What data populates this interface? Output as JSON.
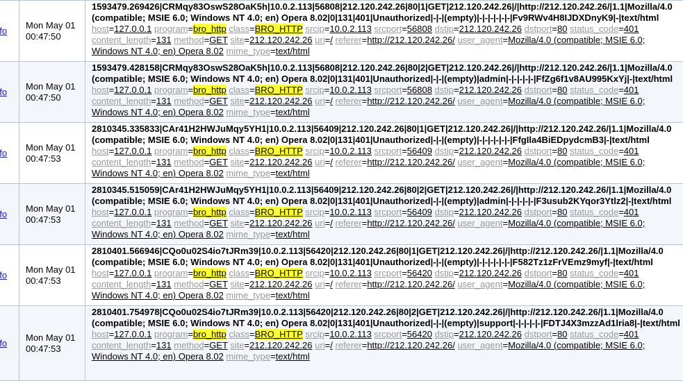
{
  "colors": {
    "highlight": "#ffff33",
    "key_text": "#999999",
    "row_alt_bg": "#f3f6fa",
    "border": "#b8c3d0",
    "link": "#1a1aa6"
  },
  "info_label": "nfo",
  "rows": [
    {
      "date": "Mon May 01",
      "time": "00:47:50",
      "raw": "1593479.269426|CRMqy83OswS28OaK5h|10.0.2.113|56808|212.120.242.26|80|1|GET|212.120.242.26|/|http://212.120.242.26/|1.1|Mozilla/4.0 (compatible; MSIE 6.0; Windows NT 4.0; en) Opera 8.02|0|131|401|Unauthorized|-|-|(empty)|-|-|-|-|-|-|Fv9RWv4H8IJDXDnyK9|-|text/html",
      "host": "127.0.0.1",
      "program": "bro_http",
      "class": "BRO_HTTP",
      "srcip": "10.0.2.113",
      "srcport": "56808",
      "dstip": "212.120.242.26",
      "dstport": "80",
      "status_code": "401",
      "content_length": "131",
      "method": "GET",
      "site": "212.120.242.26",
      "uri": "/",
      "referer": "http://212.120.242.26/",
      "user_agent": "Mozilla/4.0 (compatible; MSIE 6.0; Windows NT 4.0; en) Opera 8.02",
      "mime_type": "text/html"
    },
    {
      "date": "Mon May 01",
      "time": "00:47:50",
      "raw": "1593479.428158|CRMqy83OswS28OaK5h|10.0.2.113|56808|212.120.242.26|80|2|GET|212.120.242.26|/|http://212.120.242.26/|1.1|Mozilla/4.0 (compatible; MSIE 6.0; Windows NT 4.0; en) Opera 8.02|0|131|401|Unauthorized|-|-|(empty)|admin|-|-|-|-|-|FfZg6f1v8AU995KxYj|-|text/html",
      "host": "127.0.0.1",
      "program": "bro_http",
      "class": "BRO_HTTP",
      "srcip": "10.0.2.113",
      "srcport": "56808",
      "dstip": "212.120.242.26",
      "dstport": "80",
      "status_code": "401",
      "content_length": "131",
      "method": "GET",
      "site": "212.120.242.26",
      "uri": "/",
      "referer": "http://212.120.242.26/",
      "user_agent": "Mozilla/4.0 (compatible; MSIE 6.0; Windows NT 4.0; en) Opera 8.02",
      "mime_type": "text/html"
    },
    {
      "date": "Mon May 01",
      "time": "00:47:53",
      "raw": "2810345.335833|CAr41H2HWJuMqy5YH1|10.0.2.113|56409|212.120.242.26|80|1|GET|212.120.242.26|/|http://212.120.242.26/|1.1|Mozilla/4.0 (compatible; MSIE 6.0; Windows NT 4.0; en) Opera 8.02|0|131|401|Unauthorized|-|-|(empty)|-|-|-|-|-|-|FfgIla4BiEDpydcmB3|-|text/html",
      "host": "127.0.0.1",
      "program": "bro_http",
      "class": "BRO_HTTP",
      "srcip": "10.0.2.113",
      "srcport": "56409",
      "dstip": "212.120.242.26",
      "dstport": "80",
      "status_code": "401",
      "content_length": "131",
      "method": "GET",
      "site": "212.120.242.26",
      "uri": "/",
      "referer": "http://212.120.242.26/",
      "user_agent": "Mozilla/4.0 (compatible; MSIE 6.0; Windows NT 4.0; en) Opera 8.02",
      "mime_type": "text/html"
    },
    {
      "date": "Mon May 01",
      "time": "00:47:53",
      "raw": "2810345.515059|CAr41H2HWJuMqy5YH1|10.0.2.113|56409|212.120.242.26|80|2|GET|212.120.242.26|/|http://212.120.242.26/|1.1|Mozilla/4.0 (compatible; MSIE 6.0; Windows NT 4.0; en) Opera 8.02|0|131|401|Unauthorized|-|-|(empty)|admin|-|-|-|-|-|F3usub2KYqor3Ytlz2|-|text/html",
      "host": "127.0.0.1",
      "program": "bro_http",
      "class": "BRO_HTTP",
      "srcip": "10.0.2.113",
      "srcport": "56409",
      "dstip": "212.120.242.26",
      "dstport": "80",
      "status_code": "401",
      "content_length": "131",
      "method": "GET",
      "site": "212.120.242.26",
      "uri": "/",
      "referer": "http://212.120.242.26/",
      "user_agent": "Mozilla/4.0 (compatible; MSIE 6.0; Windows NT 4.0; en) Opera 8.02",
      "mime_type": "text/html"
    },
    {
      "date": "Mon May 01",
      "time": "00:47:53",
      "raw": "2810401.566946|CQo0u02S4io7tJRm39|10.0.2.113|56420|212.120.242.26|80|1|GET|212.120.242.26|/|http://212.120.242.26/|1.1|Mozilla/4.0 (compatible; MSIE 6.0; Windows NT 4.0; en) Opera 8.02|0|131|401|Unauthorized|-|-|(empty)|-|-|-|-|-|-|F582Tz1zFrVEmz9myf|-|text/html",
      "host": "127.0.0.1",
      "program": "bro_http",
      "class": "BRO_HTTP",
      "srcip": "10.0.2.113",
      "srcport": "56420",
      "dstip": "212.120.242.26",
      "dstport": "80",
      "status_code": "401",
      "content_length": "131",
      "method": "GET",
      "site": "212.120.242.26",
      "uri": "/",
      "referer": "http://212.120.242.26/",
      "user_agent": "Mozilla/4.0 (compatible; MSIE 6.0; Windows NT 4.0; en) Opera 8.02",
      "mime_type": "text/html"
    },
    {
      "date": "Mon May 01",
      "time": "00:47:53",
      "raw": "2810401.754978|CQo0u02S4io7tJRm39|10.0.2.113|56420|212.120.242.26|80|2|GET|212.120.242.26|/|http://212.120.242.26/|1.1|Mozilla/4.0 (compatible; MSIE 6.0; Windows NT 4.0; en) Opera 8.02|0|131|401|Unauthorized|-|-|(empty)|support|-|-|-|-|-|FDTJ4X3mzzAd1lria8|-|text/html",
      "host": "127.0.0.1",
      "program": "bro_http",
      "class": "BRO_HTTP",
      "srcip": "10.0.2.113",
      "srcport": "56420",
      "dstip": "212.120.242.26",
      "dstport": "80",
      "status_code": "401",
      "content_length": "131",
      "method": "GET",
      "site": "212.120.242.26",
      "uri": "/",
      "referer": "http://212.120.242.26/",
      "user_agent": "Mozilla/4.0 (compatible; MSIE 6.0; Windows NT 4.0; en) Opera 8.02",
      "mime_type": "text/html"
    }
  ]
}
